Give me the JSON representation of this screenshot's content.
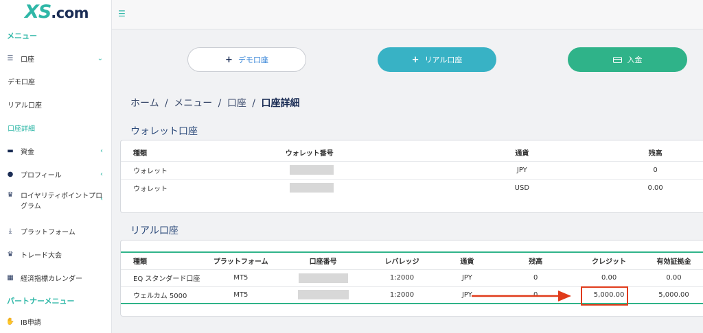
{
  "brand": {
    "logo_xs": "XS",
    "logo_com": ".com"
  },
  "sidebar": {
    "menu_title": "メニュー",
    "items": [
      {
        "label": "口座",
        "icon": "list-icon",
        "arrow": "⌄"
      },
      {
        "label": "デモ口座"
      },
      {
        "label": "リアル口座"
      },
      {
        "label": "口座詳細"
      },
      {
        "label": "資金",
        "icon": "wallet-icon",
        "arrow": "‹"
      },
      {
        "label": "プロフィール",
        "icon": "user-icon",
        "arrow": "‹"
      },
      {
        "label": "ロイヤリティポイントプログラム",
        "icon": "trophy-icon",
        "arrow": "‹"
      },
      {
        "label": "プラットフォーム",
        "icon": "download-icon"
      },
      {
        "label": "トレード大会",
        "icon": "trophy-icon"
      },
      {
        "label": "経済指標カレンダー",
        "icon": "calendar-icon"
      }
    ],
    "partner_title": "パートナーメニュー",
    "partner_items": [
      {
        "label": "IB申請",
        "icon": "handshake-icon"
      }
    ]
  },
  "actions": {
    "demo": "デモ口座",
    "real": "リアル口座",
    "deposit": "入金"
  },
  "breadcrumb": {
    "home": "ホーム",
    "menu": "メニュー",
    "account": "口座",
    "current": "口座詳細",
    "sep": "/"
  },
  "wallet": {
    "title": "ウォレット口座",
    "headers": [
      "種類",
      "ウォレット番号",
      "通貨",
      "残高"
    ],
    "rows": [
      {
        "type": "ウォレット",
        "currency": "JPY",
        "balance": "0"
      },
      {
        "type": "ウォレット",
        "currency": "USD",
        "balance": "0.00"
      }
    ]
  },
  "real": {
    "title": "リアル口座",
    "headers": [
      "種類",
      "プラットフォーム",
      "口座番号",
      "レバレッジ",
      "通貨",
      "残高",
      "クレジット",
      "有効証拠金"
    ],
    "rows": [
      {
        "type": "EQ スタンダード口座",
        "platform": "MT5",
        "leverage": "1:2000",
        "currency": "JPY",
        "balance": "0",
        "credit": "0.00",
        "equity": "0.00"
      },
      {
        "type": "ウェルカム 5000",
        "platform": "MT5",
        "leverage": "1:2000",
        "currency": "JPY",
        "balance": "0",
        "credit": "5,000.00",
        "equity": "5,000.00"
      }
    ]
  },
  "colors": {
    "accent": "#2fb7a7",
    "navy": "#1b2d55",
    "highlight": "#e03a1a"
  }
}
